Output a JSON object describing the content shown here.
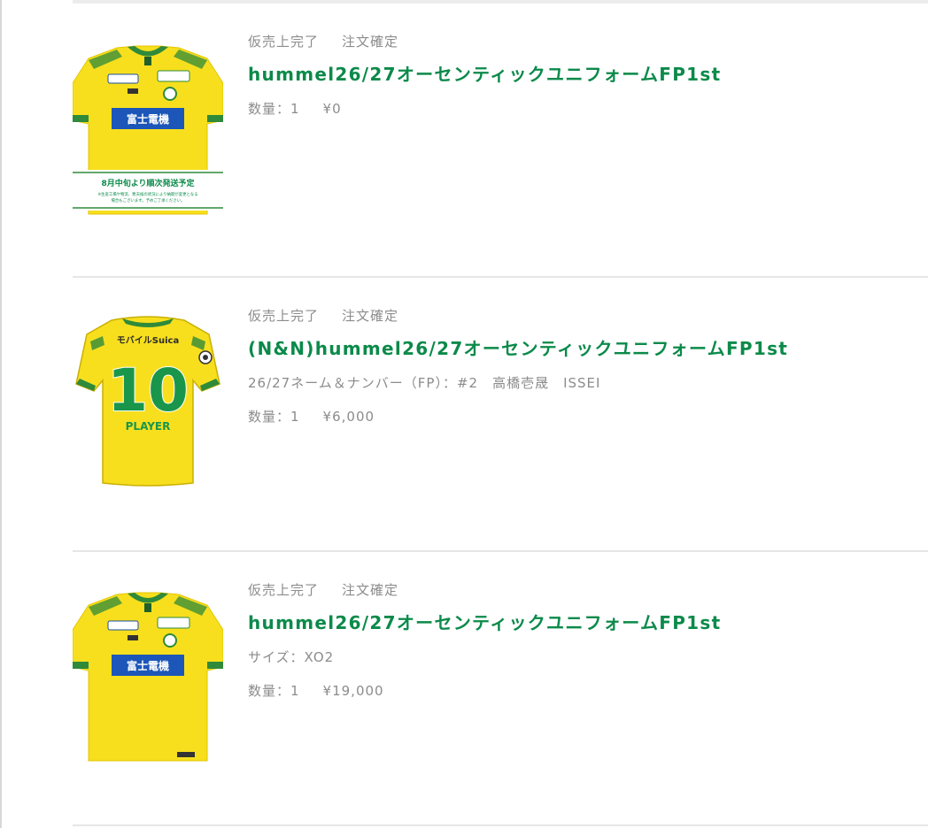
{
  "colors": {
    "accent_green": "#0b8a4a",
    "meta_gray": "#8c8c8c",
    "jersey_yellow": "#f7df1e",
    "jersey_green": "#2f8a3a"
  },
  "orders": [
    {
      "sales_status": "仮売上完了",
      "order_status": "注文確定",
      "title": "hummel26/27オーセンティックユニフォームFP1st",
      "option": "",
      "quantity": "数量：1",
      "price": "¥0",
      "image": {
        "icon": "jersey-front-icon",
        "sponsor_text": "富士電機",
        "badge_line1": "8月中旬より順次発送予定",
        "badge_line2": "※生産工場や物流、悪天候の状況により納期が変更となる",
        "badge_line3": "場合もございます。予めご了承ください。"
      }
    },
    {
      "sales_status": "仮売上完了",
      "order_status": "注文確定",
      "title": "(N&N)hummel26/27オーセンティックユニフォームFP1st",
      "option": "26/27ネーム＆ナンバー（FP）：#2　高橋壱晟　ISSEI",
      "quantity": "数量：1",
      "price": "¥6,000",
      "image": {
        "icon": "jersey-back-icon",
        "back_sponsor": "モバイルSuica",
        "number": "10",
        "player_name": "PLAYER"
      }
    },
    {
      "sales_status": "仮売上完了",
      "order_status": "注文確定",
      "title": "hummel26/27オーセンティックユニフォームFP1st",
      "option": "サイズ：XO2",
      "quantity": "数量：1",
      "price": "¥19,000",
      "image": {
        "icon": "jersey-front-icon",
        "sponsor_text": "富士電機"
      }
    }
  ]
}
